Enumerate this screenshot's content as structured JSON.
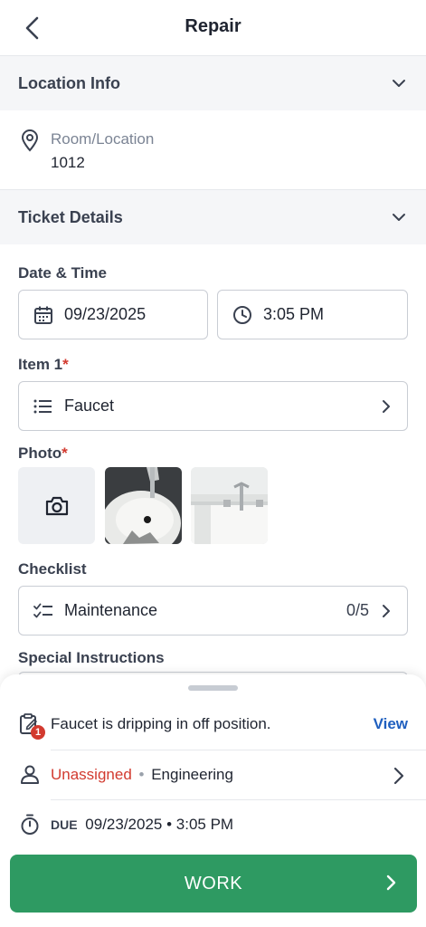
{
  "header": {
    "title": "Repair"
  },
  "location_section": {
    "title": "Location Info",
    "room_label": "Room/Location",
    "room_value": "1012"
  },
  "ticket_section": {
    "title": "Ticket Details",
    "date_time_label": "Date & Time",
    "date": "09/23/2025",
    "time": "3:05 PM",
    "item_label": "Item 1",
    "required_mark": "*",
    "item_value": "Faucet",
    "photo_label": "Photo",
    "checklist_label": "Checklist",
    "checklist_value": "Maintenance",
    "checklist_progress": "0/5",
    "special_instructions_label": "Special Instructions"
  },
  "sheet": {
    "description": "Faucet is dripping in off position.",
    "view_label": "View",
    "badge_count": "1",
    "assignee": "Unassigned",
    "separator_dot": "•",
    "department": "Engineering",
    "due_prefix": "DUE",
    "due_value": "09/23/2025 • 3:05 PM"
  },
  "actions": {
    "work_label": "WORK"
  },
  "colors": {
    "accent_green": "#2e9a62",
    "alert_red": "#d23a2f",
    "link_blue": "#1f5fbf"
  }
}
